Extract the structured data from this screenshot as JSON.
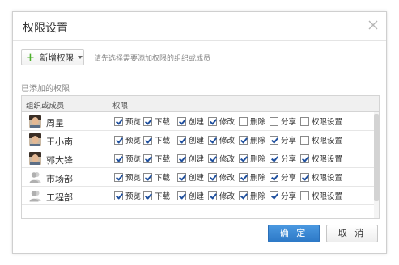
{
  "dialog": {
    "title": "权限设置",
    "close_icon": "close-icon"
  },
  "toolbar": {
    "add_label": "新增权限",
    "hint": "请先选择需要添加权限的组织或成员"
  },
  "section_label": "已添加的权限",
  "table": {
    "col_member": "组织或成员",
    "col_perm": "权限",
    "perm_labels": [
      "预览",
      "下载",
      "创建",
      "修改",
      "删除",
      "分享",
      "权限设置"
    ],
    "rows": [
      {
        "name": "周星",
        "avatar": "person-photo",
        "checks": [
          true,
          true,
          true,
          true,
          false,
          false,
          false
        ]
      },
      {
        "name": "王小南",
        "avatar": "person-photo",
        "checks": [
          true,
          true,
          true,
          true,
          true,
          true,
          false
        ]
      },
      {
        "name": "郭大锋",
        "avatar": "person-photo",
        "checks": [
          true,
          true,
          true,
          true,
          true,
          true,
          true
        ]
      },
      {
        "name": "市场部",
        "avatar": "group-icon",
        "checks": [
          true,
          true,
          true,
          true,
          true,
          true,
          true
        ]
      },
      {
        "name": "工程部",
        "avatar": "group-icon",
        "checks": [
          true,
          true,
          true,
          true,
          true,
          true,
          false
        ]
      }
    ]
  },
  "footer": {
    "ok_label": "确 定",
    "cancel_label": "取 消"
  },
  "colors": {
    "accent": "#2d79c7",
    "add_green": "#4caf2a",
    "checkmark": "#1e4f9e"
  }
}
